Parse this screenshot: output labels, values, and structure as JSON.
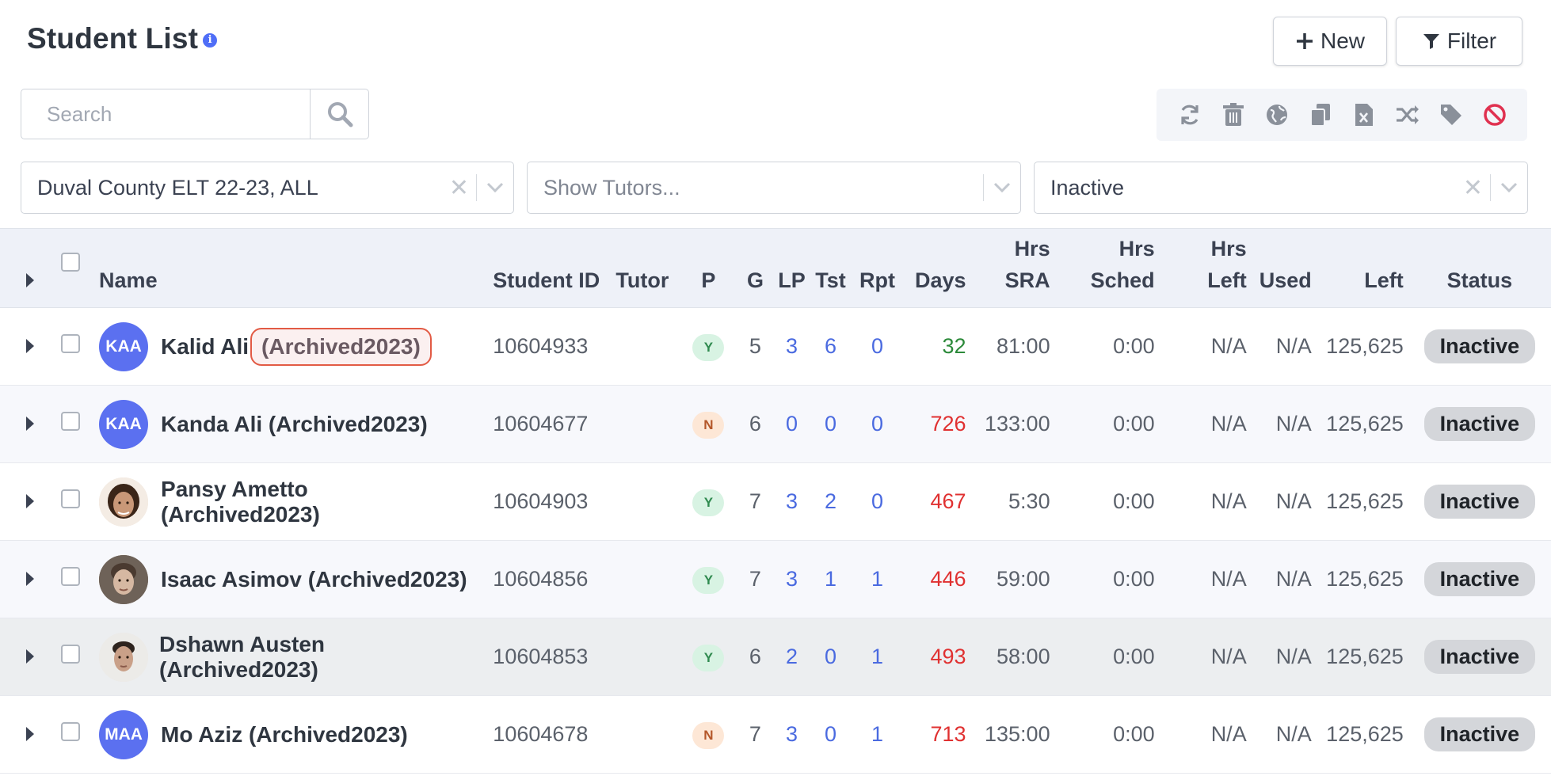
{
  "header": {
    "title": "Student List",
    "info_glyph": "i",
    "new_label": "New",
    "filter_label": "Filter"
  },
  "search": {
    "placeholder": "Search"
  },
  "toolbar_icons": [
    "refresh-icon",
    "trash-icon",
    "globe-icon",
    "copy-icon",
    "excel-icon",
    "shuffle-icon",
    "tag-icon",
    "block-icon"
  ],
  "filters": {
    "program": "Duval County ELT 22-23, ALL",
    "tutors_placeholder": "Show Tutors...",
    "status": "Inactive",
    "clear_glyph": "✕"
  },
  "columns": {
    "name": "Name",
    "student_id": "Student ID",
    "tutor": "Tutor",
    "p": "P",
    "g": "G",
    "lp": "LP",
    "tst": "Tst",
    "rpt": "Rpt",
    "days": "Days",
    "hrs_sra_1": "Hrs",
    "hrs_sra_2": "SRA",
    "hrs_sched_1": "Hrs",
    "hrs_sched_2": "Sched",
    "hrs_left_1": "Hrs",
    "hrs_left_2": "Left",
    "used": "Used",
    "left": "Left",
    "status": "Status"
  },
  "rows": [
    {
      "initials": "KAA",
      "name_a": "Kalid Ali",
      "name_b": "(Archived2023)",
      "student_id": "10604933",
      "tutor": "",
      "p": "Y",
      "g": "5",
      "lp": "3",
      "tst": "6",
      "rpt": "0",
      "days": "32",
      "hrs_sra": "81:00",
      "hrs_sched": "0:00",
      "hrs_left": "N/A",
      "used": "N/A",
      "left": "125,625",
      "status": "Inactive"
    },
    {
      "initials": "KAA",
      "name_a": "Kanda Ali (Archived2023)",
      "name_b": "",
      "student_id": "10604677",
      "tutor": "",
      "p": "N",
      "g": "6",
      "lp": "0",
      "tst": "0",
      "rpt": "0",
      "days": "726",
      "hrs_sra": "133:00",
      "hrs_sched": "0:00",
      "hrs_left": "N/A",
      "used": "N/A",
      "left": "125,625",
      "status": "Inactive"
    },
    {
      "initials": "",
      "name_a": "Pansy Ametto",
      "name_b": "(Archived2023)",
      "student_id": "10604903",
      "tutor": "",
      "p": "Y",
      "g": "7",
      "lp": "3",
      "tst": "2",
      "rpt": "0",
      "days": "467",
      "hrs_sra": "5:30",
      "hrs_sched": "0:00",
      "hrs_left": "N/A",
      "used": "N/A",
      "left": "125,625",
      "status": "Inactive"
    },
    {
      "initials": "",
      "name_a": "Isaac Asimov (Archived2023)",
      "name_b": "",
      "student_id": "10604856",
      "tutor": "",
      "p": "Y",
      "g": "7",
      "lp": "3",
      "tst": "1",
      "rpt": "1",
      "days": "446",
      "hrs_sra": "59:00",
      "hrs_sched": "0:00",
      "hrs_left": "N/A",
      "used": "N/A",
      "left": "125,625",
      "status": "Inactive"
    },
    {
      "initials": "",
      "name_a": "Dshawn Austen",
      "name_b": "(Archived2023)",
      "student_id": "10604853",
      "tutor": "",
      "p": "Y",
      "g": "6",
      "lp": "2",
      "tst": "0",
      "rpt": "1",
      "days": "493",
      "hrs_sra": "58:00",
      "hrs_sched": "0:00",
      "hrs_left": "N/A",
      "used": "N/A",
      "left": "125,625",
      "status": "Inactive"
    },
    {
      "initials": "MAA",
      "name_a": "Mo Aziz (Archived2023)",
      "name_b": "",
      "student_id": "10604678",
      "tutor": "",
      "p": "N",
      "g": "7",
      "lp": "3",
      "tst": "0",
      "rpt": "1",
      "days": "713",
      "hrs_sra": "135:00",
      "hrs_sched": "0:00",
      "hrs_left": "N/A",
      "used": "N/A",
      "left": "125,625",
      "status": "Inactive"
    }
  ],
  "colors": {
    "accent": "#5b70f0",
    "days_ok": "#2c8a3a",
    "days_late": "#e03131",
    "link": "#4a6ae0",
    "highlight_border": "#e25a44"
  }
}
